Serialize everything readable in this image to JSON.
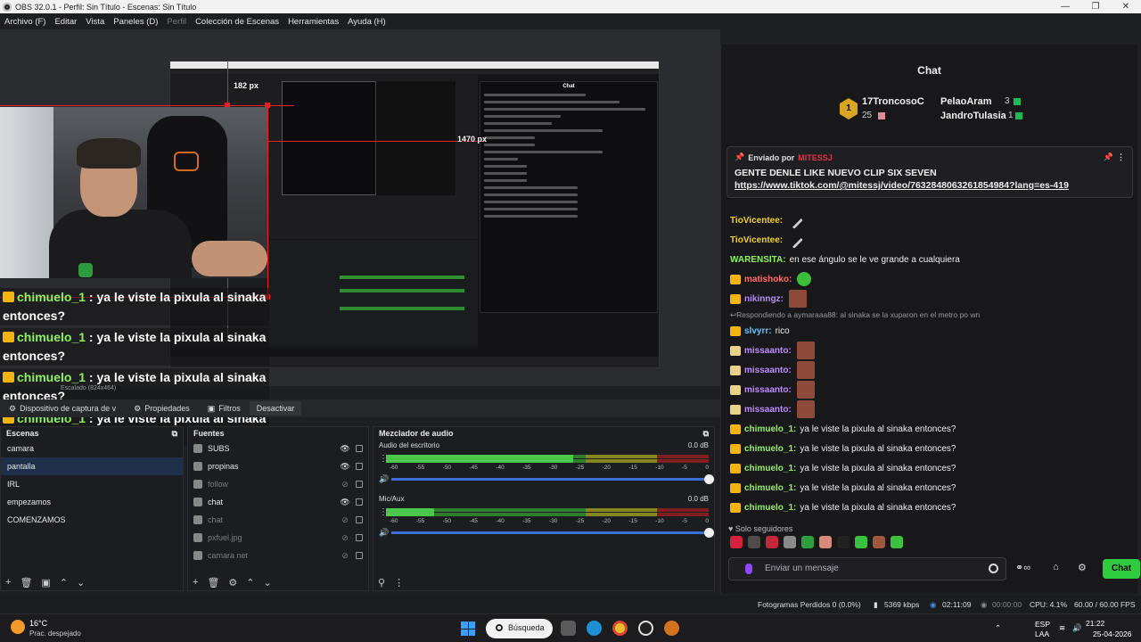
{
  "window": {
    "title": "OBS 32.0.1 - Perfil: Sin Título - Escenas: Sin Título",
    "controls": [
      "—",
      "❐",
      "✕"
    ]
  },
  "menu": [
    {
      "label": "Archivo (F)",
      "disabled": false
    },
    {
      "label": "Editar",
      "disabled": false
    },
    {
      "label": "Vista",
      "disabled": false
    },
    {
      "label": "Paneles (D)",
      "disabled": false
    },
    {
      "label": "Perfil",
      "disabled": true
    },
    {
      "label": "Colección de Escenas",
      "disabled": false
    },
    {
      "label": "Herramientas",
      "disabled": false
    },
    {
      "label": "Ayuda (H)",
      "disabled": false
    }
  ],
  "preview": {
    "px_label_top": "182 px",
    "px_label_right": "1470 px",
    "scaled_label": "Escalado (824x464)"
  },
  "overlay_messages": [
    {
      "user": "chimuelo_1",
      "text": " : ya le viste la pixula al sinaka entonces?"
    },
    {
      "user": "chimuelo_1",
      "text": " : ya le viste la pixula al sinaka entonces?"
    },
    {
      "user": "chimuelo_1",
      "text": " : ya le viste la pixula al sinaka entonces?"
    },
    {
      "user": "chimuelo_1",
      "text": " : ya le viste la pixula al sinaka entonces?"
    }
  ],
  "source_toolbar": {
    "selected_source": "Dispositivo de captura de v",
    "properties": "Propiedades",
    "filters": "Filtros",
    "deactivate": "Desactivar"
  },
  "scenes": {
    "title": "Escenas",
    "items": [
      "camara",
      "pantalla",
      "IRL",
      "empezamos",
      "COMENZAMOS"
    ],
    "active_index": 1
  },
  "sources": {
    "title": "Fuentes",
    "items": [
      {
        "name": "SUBS",
        "visible": true
      },
      {
        "name": "propinas",
        "visible": true
      },
      {
        "name": "follow",
        "visible": false
      },
      {
        "name": "chat",
        "visible": true
      },
      {
        "name": "chat",
        "visible": false
      },
      {
        "name": "pxfuel.jpg",
        "visible": false
      },
      {
        "name": "camara net",
        "visible": false
      }
    ]
  },
  "mixer": {
    "title": "Mezclador de audio",
    "channels": [
      {
        "name": "Audio del escritorio",
        "db": "0.0 dB",
        "level": 0.58
      },
      {
        "name": "Mic/Aux",
        "db": "0.0 dB",
        "level": 0.15
      }
    ],
    "scale": [
      "-60",
      "-55",
      "-50",
      "-45",
      "-40",
      "-35",
      "-30",
      "-25",
      "-20",
      "-15",
      "-10",
      "-5",
      "0"
    ]
  },
  "chat": {
    "search_placeholder": "chat",
    "header": "Chat",
    "leaderboard": [
      {
        "rank": "1",
        "name": "17TroncosoC",
        "count": "25"
      },
      {
        "name": "PelaoAram",
        "count": "3"
      },
      {
        "name": "JandroTulasia",
        "count": "1"
      }
    ],
    "pinned": {
      "by_label": "Enviado por",
      "by_user": "MITESSJ",
      "message": "GENTE DENLE LIKE NUEVO CLIP SIX SEVEN",
      "link": "https://www.tiktok.com/@mitessj/video/7632848063261854984?lang=es-419"
    },
    "messages": [
      {
        "user": "TioVicentee:",
        "color": "#f0d22a",
        "text": "",
        "emote": "brush",
        "badge": "none"
      },
      {
        "user": "TioVicentee:",
        "color": "#f0d22a",
        "text": "",
        "emote": "brush",
        "badge": "none"
      },
      {
        "user": "WARENSITA:",
        "color": "#8ef25c",
        "text": "en ese ángulo se le ve grande a cualquiera",
        "emote": "",
        "badge": "none"
      },
      {
        "user": "matishoko:",
        "color": "#ff6b6b",
        "text": "",
        "emote": "green",
        "badge": "gold"
      },
      {
        "user": "nikinngz:",
        "color": "#b88cff",
        "text": "",
        "emote": "face",
        "badge": "gold"
      },
      {
        "user": "Respondiendo a aymaraaa88: al sinaka se la xuparon en el metro po wn",
        "color": "#999999",
        "text": "",
        "emote": "",
        "badge": "reply"
      },
      {
        "user": "slvyrr:",
        "color": "#5cc8ff",
        "text": "rico",
        "emote": "",
        "badge": "gold"
      },
      {
        "user": "missaanto:",
        "color": "#c08cff",
        "text": "",
        "emote": "face",
        "badge": "pale"
      },
      {
        "user": "missaanto:",
        "color": "#c08cff",
        "text": "",
        "emote": "face",
        "badge": "pale"
      },
      {
        "user": "missaanto:",
        "color": "#c08cff",
        "text": "",
        "emote": "face",
        "badge": "pale"
      },
      {
        "user": "missaanto:",
        "color": "#c08cff",
        "text": "",
        "emote": "face",
        "badge": "pale"
      },
      {
        "user": "chimuelo_1:",
        "color": "#8ef25c",
        "text": "ya le viste la pixula al sinaka entonces?",
        "emote": "",
        "badge": "gold"
      },
      {
        "user": "chimuelo_1:",
        "color": "#8ef25c",
        "text": "ya le viste la pixula al sinaka entonces?",
        "emote": "",
        "badge": "gold"
      },
      {
        "user": "chimuelo_1:",
        "color": "#8ef25c",
        "text": "ya le viste la pixula al sinaka entonces?",
        "emote": "",
        "badge": "gold"
      },
      {
        "user": "chimuelo_1:",
        "color": "#8ef25c",
        "text": "ya le viste la pixula al sinaka entonces?",
        "emote": "",
        "badge": "gold"
      },
      {
        "user": "chimuelo_1:",
        "color": "#8ef25c",
        "text": "ya le viste la pixula al sinaka entonces?",
        "emote": "",
        "badge": "gold"
      }
    ],
    "followers_only": "Solo seguidores",
    "input_placeholder": "Enviar un mensaje",
    "send_label": "Chat"
  },
  "status": {
    "dropped": "Fotogramas Perdidos 0 (0.0%)",
    "bitrate": "5369 kbps",
    "stream_time": "02:11:09",
    "rec_time": "00:00:00",
    "cpu": "CPU: 4.1%",
    "fps": "60.00 / 60.00 FPS"
  },
  "taskbar": {
    "temp": "16°C",
    "weather": "Prac. despejado",
    "search": "Búsqueda",
    "lang": "ESP",
    "lang2": "LAA",
    "time": "21:22",
    "date": "25-04-2026"
  }
}
